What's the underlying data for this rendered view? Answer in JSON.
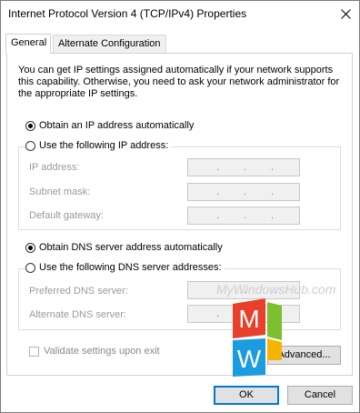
{
  "window": {
    "title": "Internet Protocol Version 4 (TCP/IPv4) Properties"
  },
  "tabs": [
    {
      "label": "General",
      "active": true
    },
    {
      "label": "Alternate Configuration",
      "active": false
    }
  ],
  "intro_text": "You can get IP settings assigned automatically if your network supports this capability. Otherwise, you need to ask your network administrator for the appropriate IP settings.",
  "ip": {
    "auto_label": "Obtain an IP address automatically",
    "manual_label": "Use the following IP address:",
    "selected": "auto",
    "fields": [
      {
        "label": "IP address:",
        "value": ""
      },
      {
        "label": "Subnet mask:",
        "value": ""
      },
      {
        "label": "Default gateway:",
        "value": ""
      }
    ]
  },
  "dns": {
    "auto_label": "Obtain DNS server address automatically",
    "manual_label": "Use the following DNS server addresses:",
    "selected": "auto",
    "fields": [
      {
        "label": "Preferred DNS server:",
        "value": ""
      },
      {
        "label": "Alternate DNS server:",
        "value": ""
      }
    ]
  },
  "validate": {
    "label": "Validate settings upon exit",
    "checked": false,
    "enabled": false
  },
  "buttons": {
    "advanced": "Advanced...",
    "ok": "OK",
    "cancel": "Cancel"
  },
  "watermark": {
    "text": "MyWindowsHub.com",
    "letters": [
      "M",
      "W"
    ]
  },
  "colors": {
    "accent": "#0078d7",
    "logo_red": "#e8402a",
    "logo_green": "#7cbf2f",
    "logo_blue": "#1b9be0",
    "logo_yellow": "#f4b400"
  }
}
